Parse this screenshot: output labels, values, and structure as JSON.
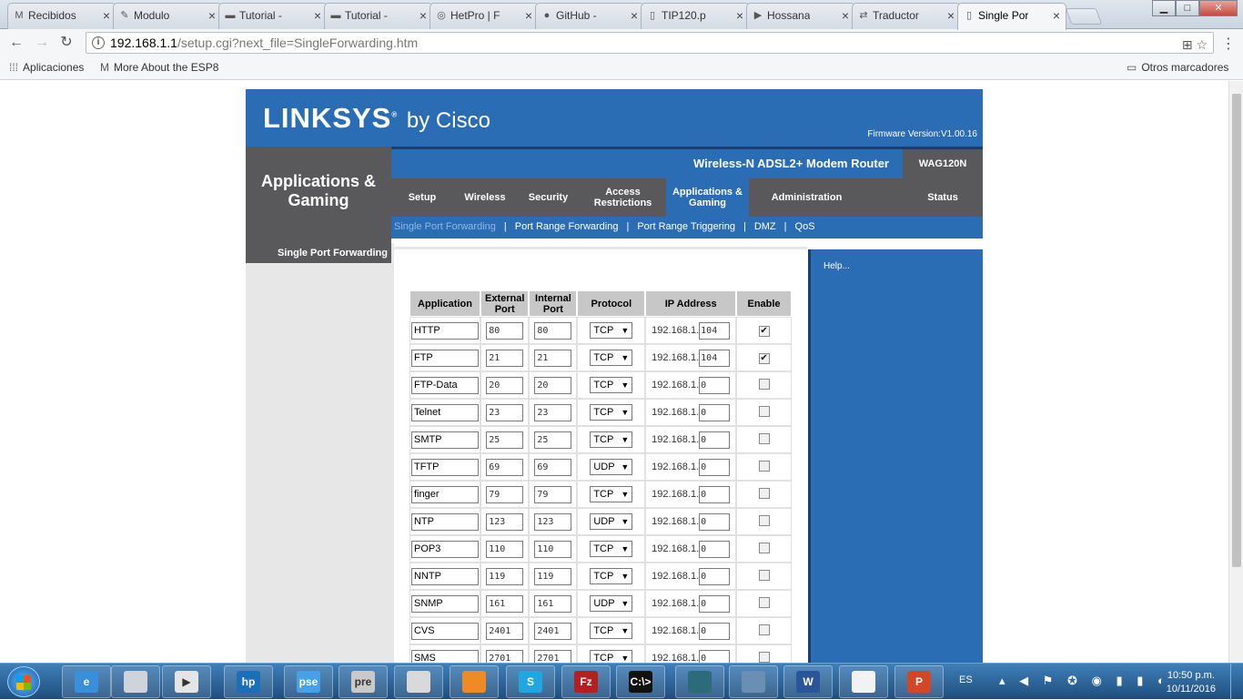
{
  "browser": {
    "tabs": [
      {
        "title": "Recibidos",
        "icon": "gmail-icon"
      },
      {
        "title": "Modulo",
        "icon": "puzzle-icon"
      },
      {
        "title": "Tutorial -",
        "icon": "page-icon"
      },
      {
        "title": "Tutorial -",
        "icon": "page-icon"
      },
      {
        "title": "HetPro | F",
        "icon": "globe-icon"
      },
      {
        "title": "GitHub -",
        "icon": "github-icon"
      },
      {
        "title": "TIP120.p",
        "icon": "document-icon"
      },
      {
        "title": "Hossana",
        "icon": "youtube-icon"
      },
      {
        "title": "Traductor",
        "icon": "translate-icon"
      },
      {
        "title": "Single Por",
        "icon": "document-icon"
      }
    ],
    "active_tab": 9,
    "url_host": "192.168.1.1",
    "url_path": "/setup.cgi?next_file=SingleForwarding.htm",
    "bookmarks": [
      {
        "label": "Aplicaciones",
        "icon": "apps-grid-icon"
      },
      {
        "label": "More About the ESP8",
        "icon": "gmail-icon"
      }
    ],
    "other_bookmarks": "Otros marcadores"
  },
  "router": {
    "brand": "LINKSYS",
    "brand_suffix": "by Cisco",
    "firmware": "Firmware Version:V1.00.16",
    "section_title": "Applications & Gaming",
    "model_name": "Wireless-N ADSL2+ Modem Router",
    "model_id": "WAG120N",
    "menu": [
      {
        "label": "Setup",
        "active": false
      },
      {
        "label": "Wireless",
        "active": false
      },
      {
        "label": "Security",
        "active": false
      },
      {
        "label": "Access Restrictions",
        "active": false
      },
      {
        "label": "Applications & Gaming",
        "active": true
      },
      {
        "label": "Administration",
        "active": false
      },
      {
        "label": "Status",
        "active": false
      }
    ],
    "submenu": [
      {
        "label": "Single Port Forwarding",
        "active": true
      },
      {
        "label": "Port Range Forwarding",
        "active": false
      },
      {
        "label": "Port Range Triggering",
        "active": false
      },
      {
        "label": "DMZ",
        "active": false
      },
      {
        "label": "QoS",
        "active": false
      }
    ],
    "left_title": "Single Port Forwarding",
    "help_label": "Help...",
    "table": {
      "headers": [
        "Application",
        "External Port",
        "Internal Port",
        "Protocol",
        "IP Address",
        "Enable"
      ],
      "ip_prefix": "192.168.1.",
      "rows": [
        {
          "app": "HTTP",
          "ext": "80",
          "int": "80",
          "proto": "TCP",
          "ip": "104",
          "enabled": true
        },
        {
          "app": "FTP",
          "ext": "21",
          "int": "21",
          "proto": "TCP",
          "ip": "104",
          "enabled": true
        },
        {
          "app": "FTP-Data",
          "ext": "20",
          "int": "20",
          "proto": "TCP",
          "ip": "0",
          "enabled": false
        },
        {
          "app": "Telnet",
          "ext": "23",
          "int": "23",
          "proto": "TCP",
          "ip": "0",
          "enabled": false
        },
        {
          "app": "SMTP",
          "ext": "25",
          "int": "25",
          "proto": "TCP",
          "ip": "0",
          "enabled": false
        },
        {
          "app": "TFTP",
          "ext": "69",
          "int": "69",
          "proto": "UDP",
          "ip": "0",
          "enabled": false
        },
        {
          "app": "finger",
          "ext": "79",
          "int": "79",
          "proto": "TCP",
          "ip": "0",
          "enabled": false
        },
        {
          "app": "NTP",
          "ext": "123",
          "int": "123",
          "proto": "UDP",
          "ip": "0",
          "enabled": false
        },
        {
          "app": "POP3",
          "ext": "110",
          "int": "110",
          "proto": "TCP",
          "ip": "0",
          "enabled": false
        },
        {
          "app": "NNTP",
          "ext": "119",
          "int": "119",
          "proto": "TCP",
          "ip": "0",
          "enabled": false
        },
        {
          "app": "SNMP",
          "ext": "161",
          "int": "161",
          "proto": "UDP",
          "ip": "0",
          "enabled": false
        },
        {
          "app": "CVS",
          "ext": "2401",
          "int": "2401",
          "proto": "TCP",
          "ip": "0",
          "enabled": false
        },
        {
          "app": "SMS",
          "ext": "2701",
          "int": "2701",
          "proto": "TCP",
          "ip": "0",
          "enabled": false
        }
      ]
    },
    "colors": {
      "brand_blue": "#2b6db5",
      "dark_gray": "#59585a"
    }
  },
  "taskbar": {
    "apps": [
      {
        "name": "ie-icon",
        "label": "e"
      },
      {
        "name": "scanner-icon",
        "label": ""
      },
      {
        "name": "media-player-icon",
        "label": "▶"
      },
      {
        "name": "hp-icon",
        "label": "hp"
      },
      {
        "name": "pse-icon",
        "label": "pse"
      },
      {
        "name": "pre-icon",
        "label": "pre"
      },
      {
        "name": "chrome-icon",
        "label": ""
      },
      {
        "name": "firefox-icon",
        "label": ""
      },
      {
        "name": "skype-icon",
        "label": "S"
      },
      {
        "name": "filezilla-icon",
        "label": "Fz"
      },
      {
        "name": "cmd-icon",
        "label": "C:\\>"
      },
      {
        "name": "arduino-icon",
        "label": ""
      },
      {
        "name": "network-icon",
        "label": ""
      },
      {
        "name": "word-icon",
        "label": "W"
      },
      {
        "name": "pdf-icon",
        "label": ""
      },
      {
        "name": "powerpoint-icon",
        "label": "P"
      }
    ],
    "language": "ES",
    "time": "10:50 p.m.",
    "date": "10/11/2016"
  }
}
